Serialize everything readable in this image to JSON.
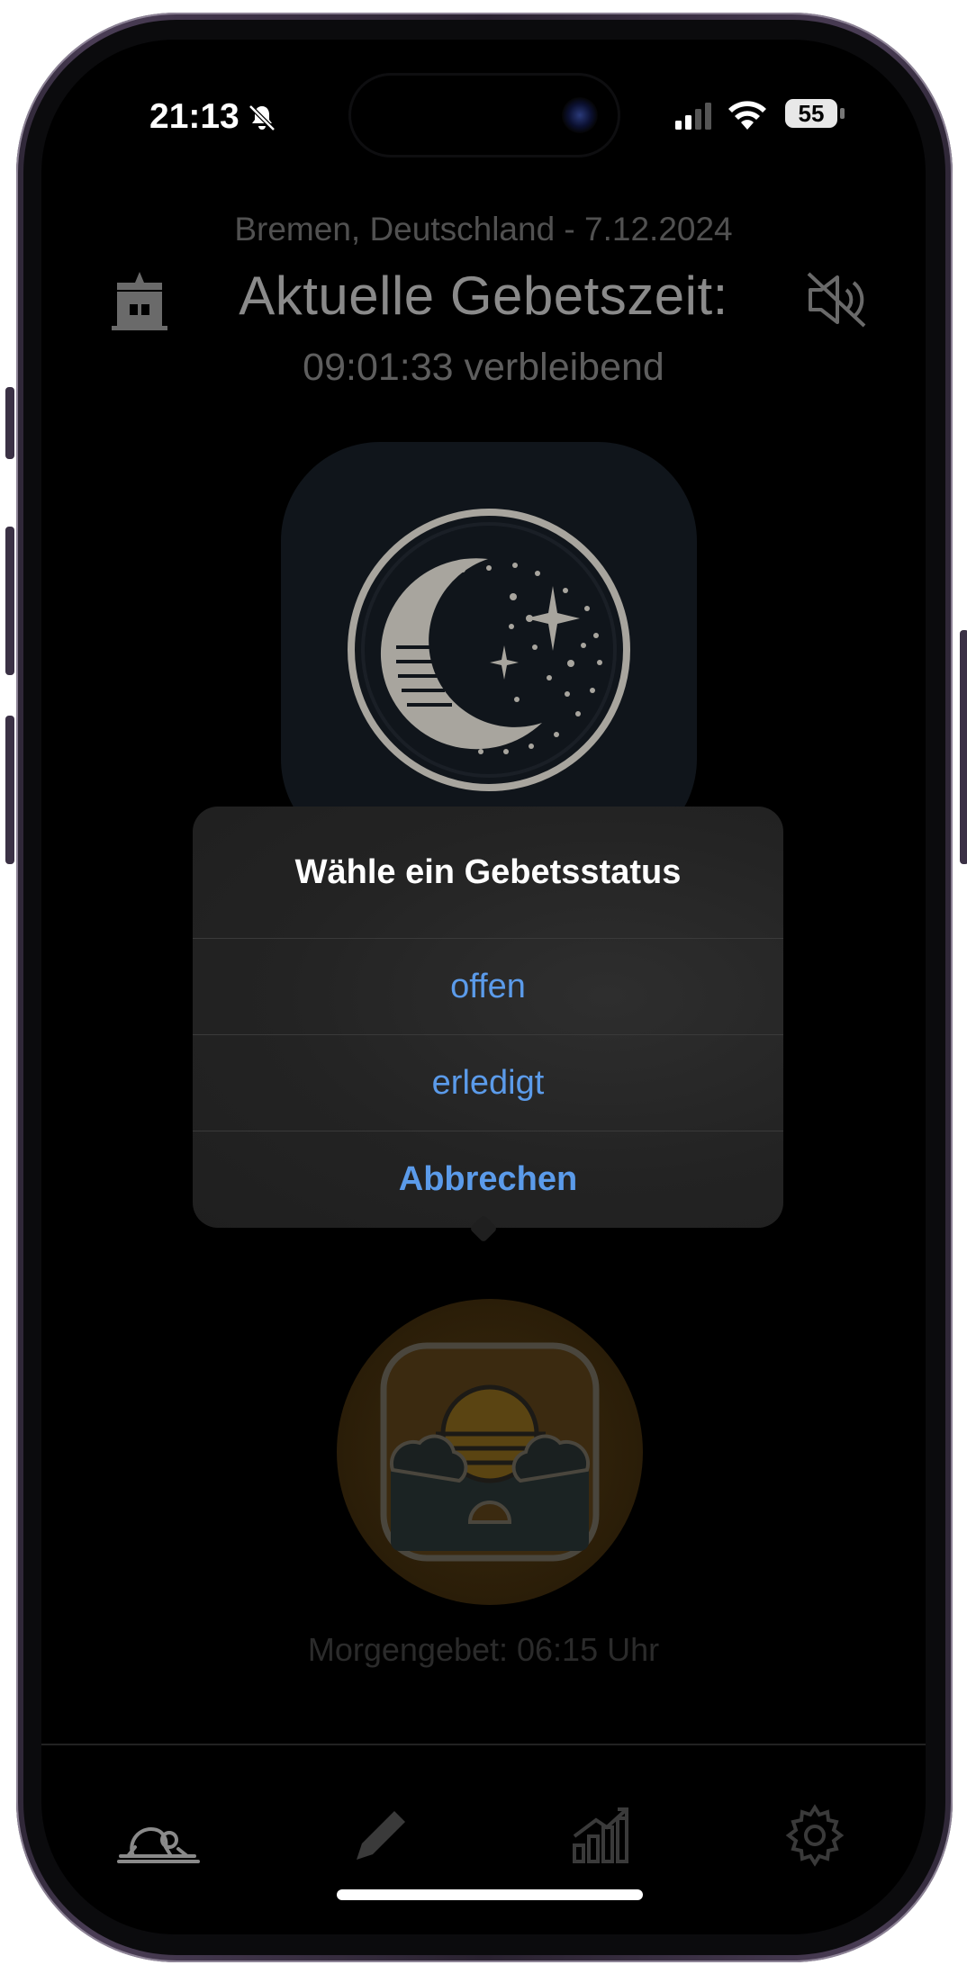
{
  "status_bar": {
    "time": "21:13",
    "battery": "55"
  },
  "header": {
    "location_date": "Bremen, Deutschland - 7.12.2024",
    "title": "Aktuelle Gebetszeit:",
    "remaining": "09:01:33 verbleibend"
  },
  "next_prayer": {
    "label": "Morgengebet: 06:15 Uhr"
  },
  "action_sheet": {
    "title": "Wähle ein Gebetsstatus",
    "options": [
      "offen",
      "erledigt"
    ],
    "cancel": "Abbrechen"
  },
  "tabs": [
    {
      "icon": "prayer-icon",
      "active": true
    },
    {
      "icon": "pencil-icon",
      "active": false
    },
    {
      "icon": "chart-icon",
      "active": false
    },
    {
      "icon": "gear-icon",
      "active": false
    }
  ],
  "colors": {
    "accent": "#5b9bea",
    "background": "#000000",
    "sheet": "#232323"
  }
}
